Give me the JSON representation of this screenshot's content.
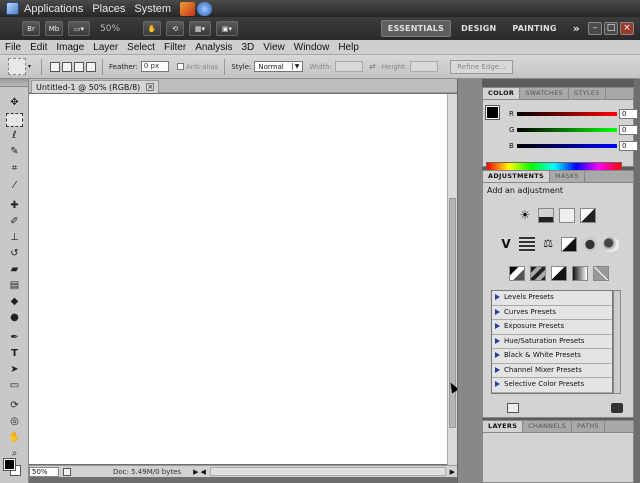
{
  "gnome_menu": [
    "Applications",
    "Places",
    "System"
  ],
  "app_bar": {
    "zoom": "50%",
    "workspaces": [
      "ESSENTIALS",
      "DESIGN",
      "PAINTING"
    ],
    "overflow": "»",
    "btn_br": "Br",
    "btn_mb": "Mb"
  },
  "menu": [
    "File",
    "Edit",
    "Image",
    "Layer",
    "Select",
    "Filter",
    "Analysis",
    "3D",
    "View",
    "Window",
    "Help"
  ],
  "options": {
    "feather_label": "Feather:",
    "feather_value": "0 px",
    "anti_alias_label": "Anti-alias",
    "style_label": "Style:",
    "style_value": "Normal",
    "width_label": "Width:",
    "height_label": "Height:",
    "refine_edge": "Refine Edge..."
  },
  "document": {
    "tab_title": "Untitled-1 @ 50% (RGB/8)",
    "zoom_field": "50%",
    "doc_info": "Doc: 5.49M/0 bytes"
  },
  "color_panel": {
    "tabs": [
      "COLOR",
      "SWATCHES",
      "STYLES"
    ],
    "channels": [
      {
        "label": "R",
        "value": "0",
        "gradient": "linear-gradient(to right,#000,#f00)"
      },
      {
        "label": "G",
        "value": "0",
        "gradient": "linear-gradient(to right,#000,#0f0)"
      },
      {
        "label": "B",
        "value": "0",
        "gradient": "linear-gradient(to right,#000,#00f)"
      }
    ]
  },
  "adjustments_panel": {
    "tabs": [
      "ADJUSTMENTS",
      "MASKS"
    ],
    "heading": "Add an adjustment",
    "presets": [
      "Levels Presets",
      "Curves Presets",
      "Exposure Presets",
      "Hue/Saturation Presets",
      "Black & White Presets",
      "Channel Mixer Presets",
      "Selective Color Presets"
    ]
  },
  "layers_panel": {
    "tabs": [
      "LAYERS",
      "CHANNELS",
      "PATHS"
    ]
  }
}
